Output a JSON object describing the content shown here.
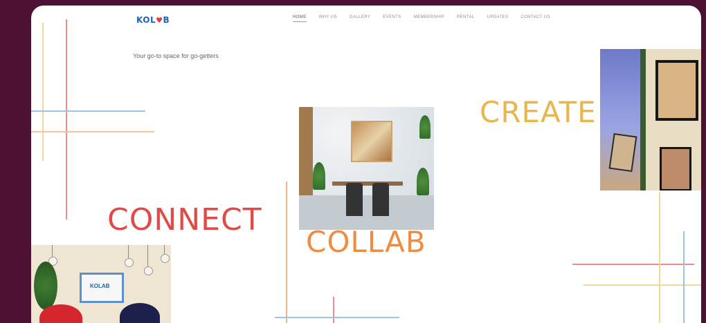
{
  "brand": {
    "logo_left": "KOL",
    "logo_heart": "♥",
    "logo_right": "B"
  },
  "nav": [
    "HOME",
    "WHY US",
    "GALLERY",
    "EVENTS",
    "MEMBERSHIP",
    "RENTAL",
    "UPDATES",
    "CONTACT US"
  ],
  "nav_active": "HOME",
  "tagline": "Your go-to space for go-getters",
  "hero_words": {
    "connect": "CONNECT",
    "create": "CREATE",
    "collab": "COLLAB"
  },
  "lounge_monitor_text": "KOLAB",
  "colors": {
    "red": "#df4b49",
    "yellow": "#e8b64a",
    "orange": "#ef8c42",
    "blue": "#1c63b8",
    "background": "#4d1233"
  }
}
